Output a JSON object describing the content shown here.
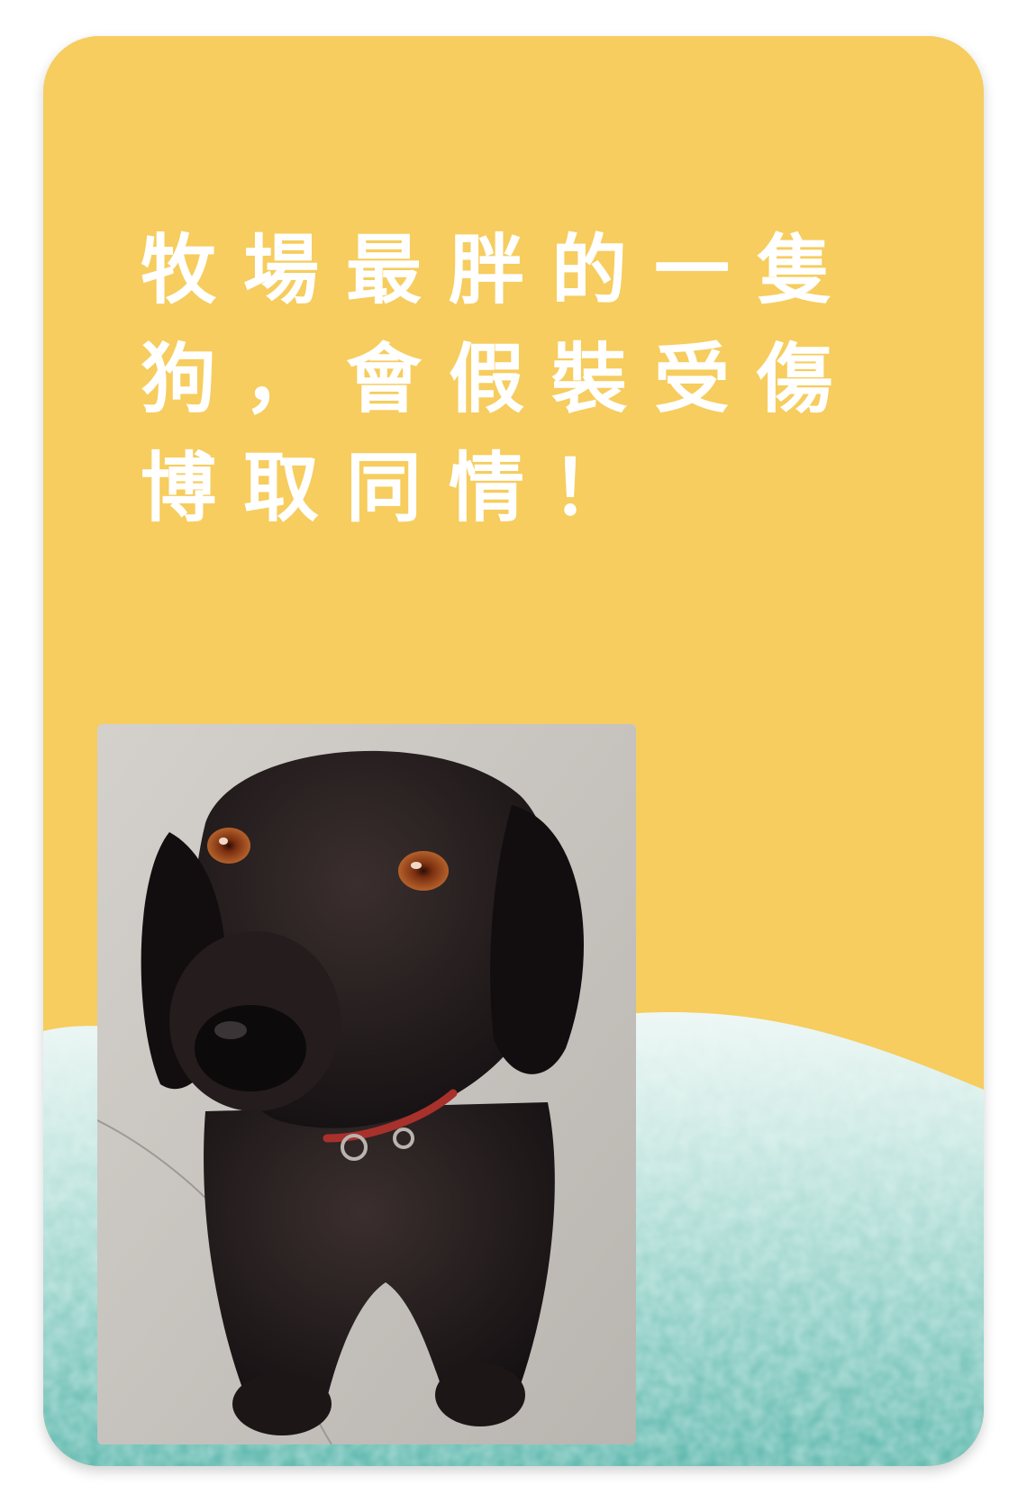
{
  "card": {
    "headline": "牧場最胖的一隻狗，會假裝受傷博取同情！",
    "background_color": "#f6cd5e",
    "wave_color_top": "#e9f5f2",
    "wave_color_bottom": "#6fc1b8"
  },
  "photo": {
    "subject": "black-dog-photo",
    "collar_color": "#a8312c"
  }
}
